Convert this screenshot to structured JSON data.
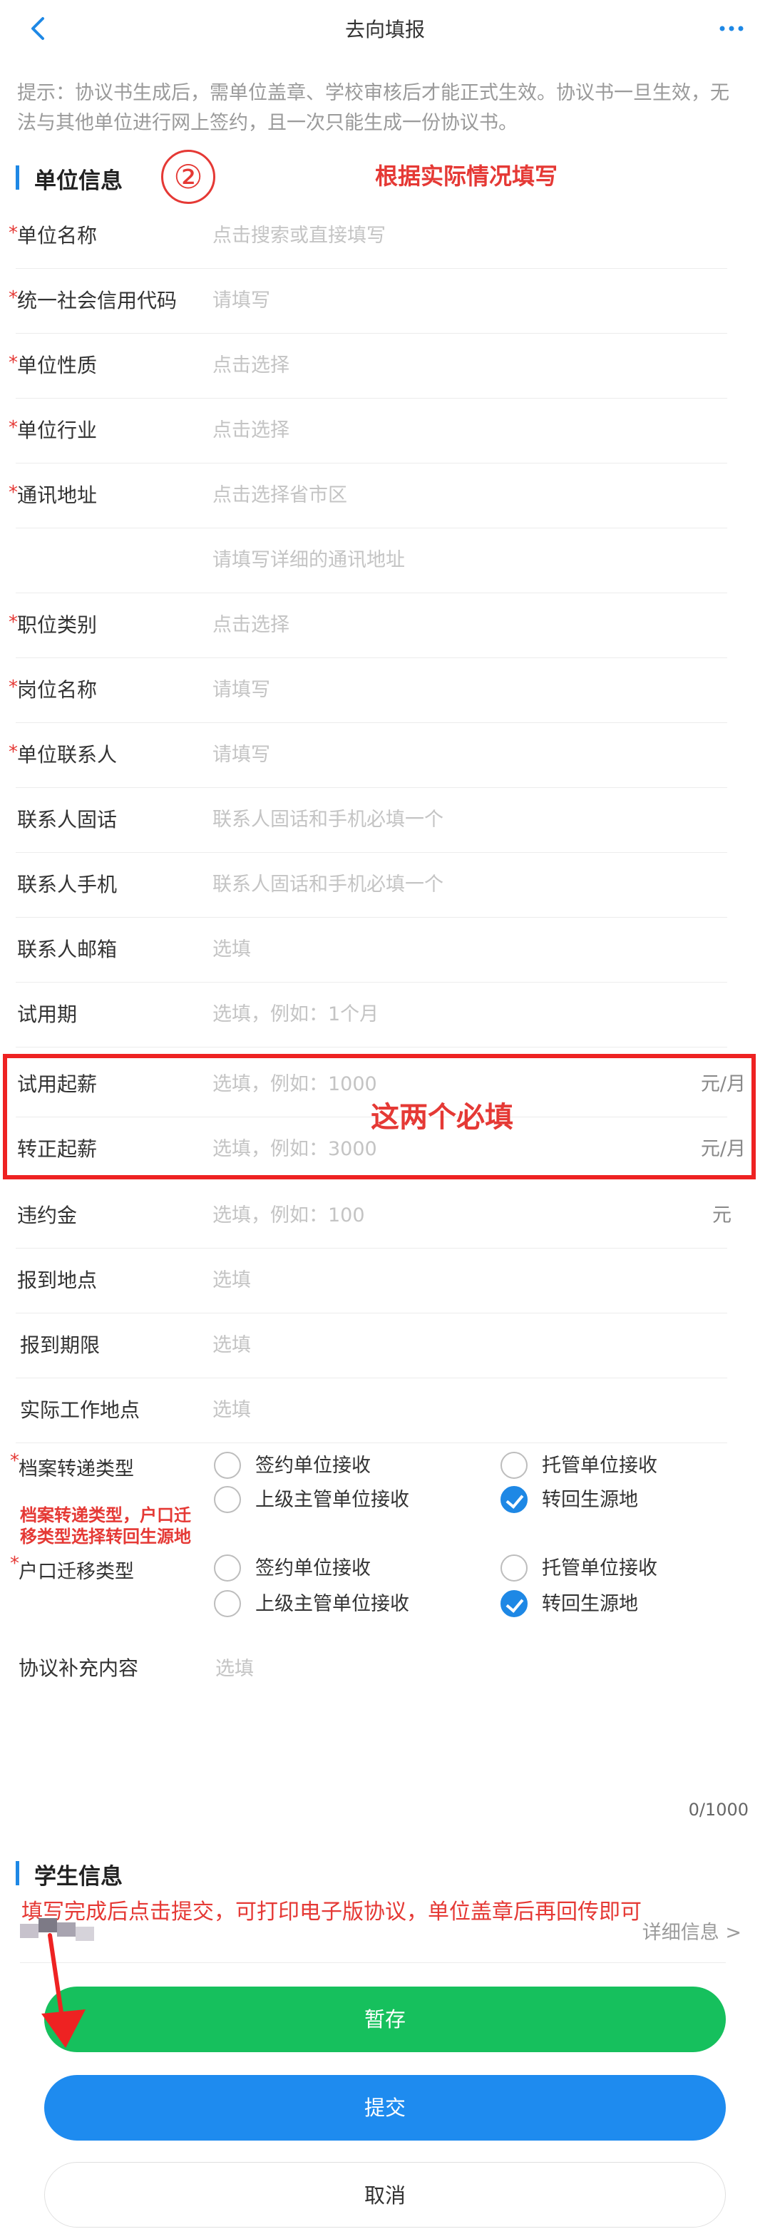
{
  "header": {
    "title": "去向填报"
  },
  "hint": "提示：协议书生成后，需单位盖章、学校审核后才能正式生效。协议书一旦生效，无法与其他单位进行网上签约，且一次只能生成一份协议书。",
  "unit_section": {
    "title": "单位信息",
    "step_number": "②",
    "annotation": "根据实际情况填写"
  },
  "fields": [
    {
      "label": "单位名称",
      "required": true,
      "placeholder": "点击搜索或直接填写"
    },
    {
      "label": "统一社会信用代码",
      "required": true,
      "placeholder": "请填写"
    },
    {
      "label": "单位性质",
      "required": true,
      "placeholder": "点击选择"
    },
    {
      "label": "单位行业",
      "required": true,
      "placeholder": "点击选择"
    },
    {
      "label": "通讯地址",
      "required": true,
      "placeholder": "点击选择省市区"
    },
    {
      "label": "",
      "required": false,
      "placeholder": "请填写详细的通讯地址"
    },
    {
      "label": "职位类别",
      "required": true,
      "placeholder": "点击选择"
    },
    {
      "label": "岗位名称",
      "required": true,
      "placeholder": "请填写"
    },
    {
      "label": "单位联系人",
      "required": true,
      "placeholder": "请填写"
    },
    {
      "label": "联系人固话",
      "required": false,
      "placeholder": "联系人固话和手机必填一个"
    },
    {
      "label": "联系人手机",
      "required": false,
      "placeholder": "联系人固话和手机必填一个"
    },
    {
      "label": "联系人邮箱",
      "required": false,
      "placeholder": "选填"
    },
    {
      "label": "试用期",
      "required": false,
      "placeholder": "选填，例如：1个月"
    },
    {
      "label": "试用起薪",
      "required": false,
      "placeholder": "选填，例如：1000",
      "unit": "元/月"
    },
    {
      "label": "转正起薪",
      "required": false,
      "placeholder": "选填，例如：3000",
      "unit": "元/月"
    },
    {
      "label": "违约金",
      "required": false,
      "placeholder": "选填，例如：100",
      "unit": "元"
    },
    {
      "label": "报到地点",
      "required": false,
      "placeholder": "选填"
    },
    {
      "label": "报到期限",
      "required": false,
      "placeholder": "选填"
    },
    {
      "label": "实际工作地点",
      "required": false,
      "placeholder": "选填"
    }
  ],
  "salary_annotation": "这两个必填",
  "archive_transfer": {
    "label": "档案转递类型",
    "options": [
      "签约单位接收",
      "托管单位接收",
      "上级主管单位接收",
      "转回生源地"
    ],
    "selected": "转回生源地"
  },
  "hukou_transfer": {
    "label": "户口迁移类型",
    "options": [
      "签约单位接收",
      "托管单位接收",
      "上级主管单位接收",
      "转回生源地"
    ],
    "selected": "转回生源地"
  },
  "transfer_annotation_line1": "档案转递类型，户口迁",
  "transfer_annotation_line2": "移类型选择转回生源地",
  "supplement": {
    "label": "协议补充内容",
    "placeholder": "选填",
    "counter": "0/1000"
  },
  "student_section": {
    "title": "学生信息",
    "detail_link": "详细信息 >",
    "annotation": "填写完成后点击提交，可打印电子版协议，单位盖章后再回传即可"
  },
  "buttons": {
    "save": "暂存",
    "submit": "提交",
    "cancel": "取消"
  },
  "colors": {
    "primary": "#1e88e5",
    "save_green": "#16c05d",
    "annotation_red": "#e53935",
    "required_red": "#e53935"
  }
}
